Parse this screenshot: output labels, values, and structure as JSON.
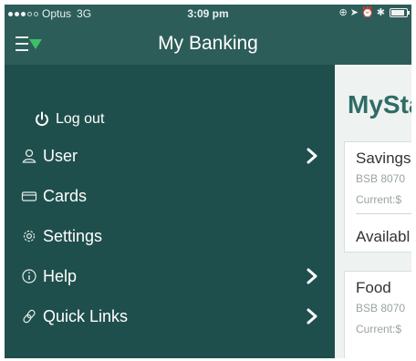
{
  "status_bar": {
    "carrier": "Optus",
    "network": "3G",
    "time": "3:09 pm",
    "right_indicators": "⊕ ➤ ⏰ ✱",
    "signal_bars_filled": 3,
    "signal_bars_total": 5,
    "battery_level": 0.85
  },
  "nav": {
    "title": "My Banking",
    "menu_icon": "menu-toggle-icon",
    "accent_color": "#3dbf66"
  },
  "menu": {
    "logout": {
      "label": "Log out",
      "icon": "power-icon"
    },
    "items": [
      {
        "label": "User",
        "icon": "user-icon",
        "has_chevron": true
      },
      {
        "label": "Cards",
        "icon": "card-icon",
        "has_chevron": false
      },
      {
        "label": "Settings",
        "icon": "gear-icon",
        "has_chevron": false
      },
      {
        "label": "Help",
        "icon": "info-icon",
        "has_chevron": true
      },
      {
        "label": "Quick Links",
        "icon": "link-icon",
        "has_chevron": true
      }
    ]
  },
  "content": {
    "title": "MySta",
    "accounts": [
      {
        "name": "Savings",
        "bsb": "BSB 8070",
        "current": "Current:$",
        "available": "Availabl"
      },
      {
        "name": "Food",
        "bsb": "BSB 8070",
        "current": "Current:$"
      }
    ]
  },
  "colors": {
    "menu_bg": "#1f4f4c",
    "bar_bg": "#2d5d59",
    "title_color": "#2f6b66"
  }
}
